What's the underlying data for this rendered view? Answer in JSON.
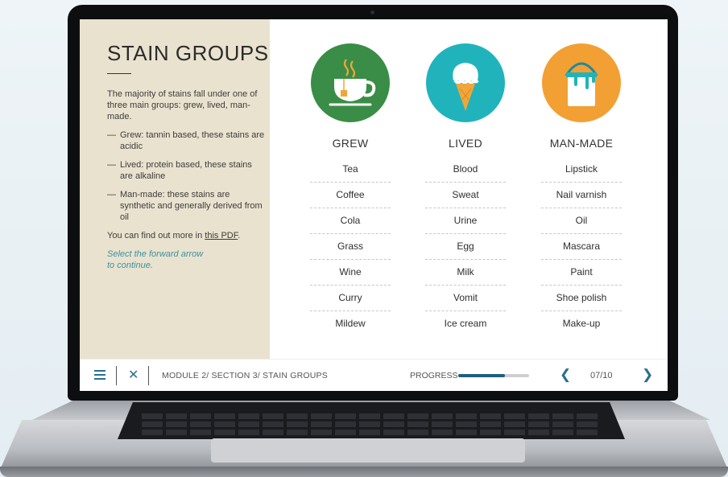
{
  "slide": {
    "title": "STAIN GROUPS",
    "intro": "The majority of stains fall under one of three main groups: grew, lived, man-made.",
    "bullets": [
      "Grew: tannin based, these stains are acidic",
      "Lived: protein based, these stains are alkaline",
      "Man-made: these stains are synthetic and generally derived from oil"
    ],
    "more_prefix": "You can find out more in ",
    "more_link": "this PDF",
    "more_suffix": ".",
    "note": "Select the forward arrow to continue."
  },
  "columns": [
    {
      "title": "GREW",
      "icon": "teacup-icon",
      "color": "#3a8d46",
      "items": [
        "Tea",
        "Coffee",
        "Cola",
        "Grass",
        "Wine",
        "Curry",
        "Mildew"
      ]
    },
    {
      "title": "LIVED",
      "icon": "ice-cream-icon",
      "color": "#21b3bc",
      "items": [
        "Blood",
        "Sweat",
        "Urine",
        "Egg",
        "Milk",
        "Vomit",
        "Ice cream"
      ]
    },
    {
      "title": "MAN-MADE",
      "icon": "paint-bucket-icon",
      "color": "#f2a033",
      "items": [
        "Lipstick",
        "Nail varnish",
        "Oil",
        "Mascara",
        "Paint",
        "Shoe polish",
        "Make-up"
      ]
    }
  ],
  "bottom_bar": {
    "breadcrumb": "MODULE 2/ SECTION 3/ STAIN GROUPS",
    "progress_label": "PROGRESS",
    "progress_fraction": 0.66,
    "page": "07/10",
    "accent": "#2a6f8c"
  }
}
